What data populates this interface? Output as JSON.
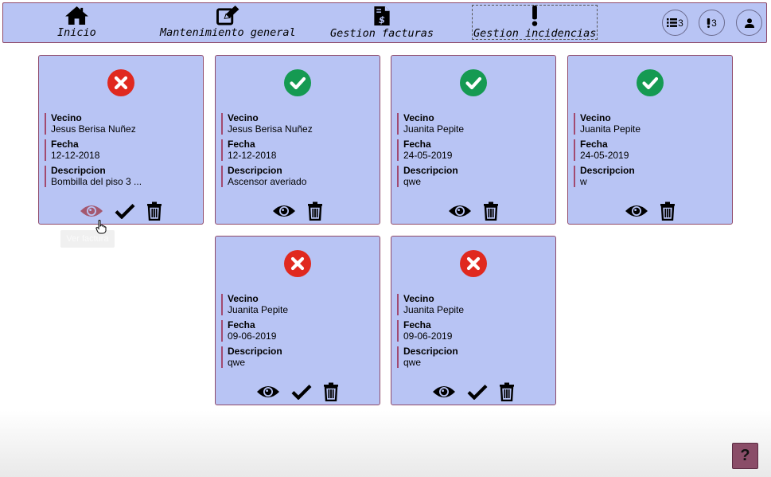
{
  "nav": {
    "items": [
      {
        "label": "Inicio",
        "icon": "home-icon"
      },
      {
        "label": "Mantenimiento general",
        "icon": "edit-icon"
      },
      {
        "label": "Gestion facturas",
        "icon": "invoice-icon"
      },
      {
        "label": "Gestion incidencias",
        "icon": "exclamation-icon",
        "active": true
      }
    ],
    "list_count": "3",
    "alert_count": "3",
    "user_icon": "user-icon"
  },
  "field_labels": {
    "vecino": "Vecino",
    "fecha": "Fecha",
    "descripcion": "Descripcion"
  },
  "incidencias": [
    {
      "status": "open",
      "vecino": "Jesus Berisa Nuñez",
      "fecha": "12-12-2018",
      "descripcion": "Bombilla del piso 3 ...",
      "can_resolve": true
    },
    {
      "status": "resolved",
      "vecino": "Jesus Berisa Nuñez",
      "fecha": "12-12-2018",
      "descripcion": "Ascensor averiado",
      "can_resolve": false
    },
    {
      "status": "resolved",
      "vecino": "Juanita Pepite",
      "fecha": "24-05-2019",
      "descripcion": "qwe",
      "can_resolve": false
    },
    {
      "status": "resolved",
      "vecino": "Juanita Pepite",
      "fecha": "24-05-2019",
      "descripcion": "w",
      "can_resolve": false
    },
    {
      "status": "open",
      "vecino": "Juanita Pepite",
      "fecha": "09-06-2019",
      "descripcion": "qwe",
      "can_resolve": true
    },
    {
      "status": "open",
      "vecino": "Juanita Pepite",
      "fecha": "09-06-2019",
      "descripcion": "qwe",
      "can_resolve": true
    }
  ],
  "tooltip": "Ver factura",
  "help_label": "?",
  "colors": {
    "card_bg": "#b8c4f4",
    "border": "#8f4a6a",
    "open": "#e0291f",
    "resolved": "#159a52",
    "eye_hover": "#a4586f"
  }
}
